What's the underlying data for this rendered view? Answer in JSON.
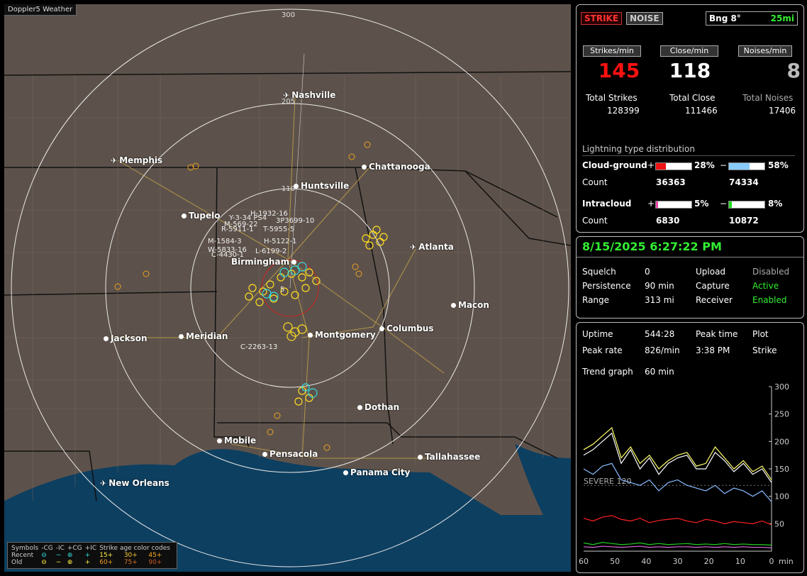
{
  "app": {
    "title": "Doppler5 Weather"
  },
  "map": {
    "cities": [
      {
        "name": "Nashville",
        "airport": true
      },
      {
        "name": "Memphis",
        "airport": true
      },
      {
        "name": "Chattanooga",
        "airport": false
      },
      {
        "name": "Huntsville",
        "airport": false
      },
      {
        "name": "Tupelo",
        "airport": false
      },
      {
        "name": "Atlanta",
        "airport": true
      },
      {
        "name": "Birmingham",
        "airport": false
      },
      {
        "name": "Macon",
        "airport": false
      },
      {
        "name": "Jackson",
        "airport": false
      },
      {
        "name": "Meridian",
        "airport": false
      },
      {
        "name": "Montgomery",
        "airport": false
      },
      {
        "name": "Columbus",
        "airport": false
      },
      {
        "name": "Dothan",
        "airport": false
      },
      {
        "name": "Mobile",
        "airport": false
      },
      {
        "name": "Pensacola",
        "airport": false
      },
      {
        "name": "Tallahassee",
        "airport": false
      },
      {
        "name": "Panama City",
        "airport": false
      },
      {
        "name": "New Orleans",
        "airport": true
      }
    ],
    "ring_labels": [
      "300",
      "205",
      "110"
    ],
    "storm_labels": [
      "H-1932-16",
      "Y-3-34 PS4",
      "M-569-22",
      "3P3699-10",
      "R-5911-1",
      "T-5955-5",
      "M-1584-3",
      "H-5122-1",
      "W-5833-16",
      "L-6199-2",
      "C-4430-1",
      "5",
      "C-2263-13"
    ]
  },
  "legend": {
    "symbols_label": "Symbols",
    "headers": [
      "-CG",
      "-IC",
      "+CG",
      "+IC"
    ],
    "age_label": "Strike age color codes",
    "recent_label": "Recent",
    "old_label": "Old",
    "recent_symbols": [
      "⊖",
      "−",
      "⊕",
      "+"
    ],
    "old_symbols": [
      "⊖",
      "−",
      "⊕",
      "+"
    ],
    "recent_ages": [
      "15+",
      "30+",
      "45+"
    ],
    "old_ages": [
      "60+",
      "75+",
      "90+"
    ]
  },
  "top_panel": {
    "strike_btn": "STRIKE",
    "noise_btn": "NOISE",
    "bearing": "Bng 8°",
    "range": "25mi",
    "strikes_hdr": "Strikes/min",
    "close_hdr": "Close/min",
    "noises_hdr": "Noises/min",
    "strikes_val": "145",
    "close_val": "118",
    "noises_val": "8",
    "total_strikes_label": "Total Strikes",
    "total_close_label": "Total Close",
    "total_noises_label": "Total Noises",
    "total_strikes": "128399",
    "total_close": "111466",
    "total_noises": "17406",
    "dist_title": "Lightning type distribution",
    "cg_label": "Cloud-ground",
    "ic_label": "Intracloud",
    "count_label": "Count",
    "plus": "+",
    "minus": "−",
    "cg_pos_pct": "28%",
    "cg_neg_pct": "58%",
    "cg_pos_count": "36363",
    "cg_neg_count": "74334",
    "ic_pos_pct": "5%",
    "ic_neg_pct": "8%",
    "ic_pos_count": "6830",
    "ic_neg_count": "10872",
    "cg_pos_frac": 0.28,
    "cg_neg_frac": 0.58,
    "ic_pos_frac": 0.05,
    "ic_neg_frac": 0.08
  },
  "status_panel": {
    "datetime": "8/15/2025 6:27:22 PM",
    "squelch_label": "Squelch",
    "squelch": "0",
    "persistence_label": "Persistence",
    "persistence": "90 min",
    "range_label": "Range",
    "range": "313 mi",
    "upload_label": "Upload",
    "upload": "Disabled",
    "capture_label": "Capture",
    "capture": "Active",
    "receiver_label": "Receiver",
    "receiver": "Enabled"
  },
  "trend_panel": {
    "uptime_label": "Uptime",
    "uptime": "544:28",
    "peak_time_label": "Peak time",
    "peak_time": "3:38 PM",
    "plot_label": "Plot",
    "plot": "Strike",
    "peak_rate_label": "Peak rate",
    "peak_rate": "826/min",
    "trend_label": "Trend graph",
    "trend": "60 min",
    "severe_label": "SEVERE 120"
  },
  "chart_data": {
    "type": "line",
    "title": "",
    "xlabel": "min",
    "ylabel": "",
    "x_ticks": [
      60,
      50,
      40,
      30,
      20,
      10,
      0
    ],
    "y_ticks": [
      50,
      100,
      150,
      200,
      250,
      300
    ],
    "xlim": [
      60,
      0
    ],
    "ylim": [
      0,
      300
    ],
    "severe_threshold": 120,
    "x": [
      60,
      57,
      54,
      51,
      48,
      45,
      42,
      39,
      36,
      33,
      30,
      27,
      24,
      21,
      18,
      15,
      12,
      9,
      6,
      3,
      0
    ],
    "series": [
      {
        "color": "#ffff66",
        "values": [
          185,
          195,
          210,
          225,
          170,
          190,
          160,
          175,
          150,
          165,
          175,
          180,
          155,
          160,
          190,
          170,
          150,
          165,
          145,
          155,
          130
        ]
      },
      {
        "color": "#ffffff",
        "values": [
          175,
          185,
          200,
          215,
          160,
          185,
          150,
          170,
          140,
          160,
          170,
          175,
          150,
          150,
          180,
          165,
          145,
          160,
          140,
          150,
          125
        ]
      },
      {
        "color": "#88bbff",
        "values": [
          150,
          140,
          155,
          160,
          130,
          125,
          120,
          130,
          110,
          125,
          130,
          120,
          115,
          110,
          120,
          105,
          115,
          110,
          100,
          110,
          90
        ]
      },
      {
        "color": "#ff2222",
        "values": [
          60,
          55,
          62,
          65,
          58,
          55,
          60,
          52,
          56,
          58,
          60,
          55,
          52,
          58,
          55,
          50,
          54,
          52,
          50,
          55,
          48
        ]
      },
      {
        "color": "#22cc22",
        "values": [
          15,
          12,
          16,
          14,
          12,
          13,
          15,
          12,
          14,
          12,
          13,
          14,
          12,
          13,
          12,
          14,
          12,
          13,
          12,
          12,
          11
        ]
      },
      {
        "color": "#dd66dd",
        "values": [
          8,
          7,
          9,
          8,
          7,
          8,
          9,
          7,
          8,
          7,
          8,
          8,
          7,
          8,
          7,
          8,
          7,
          8,
          7,
          7,
          6
        ]
      }
    ]
  }
}
